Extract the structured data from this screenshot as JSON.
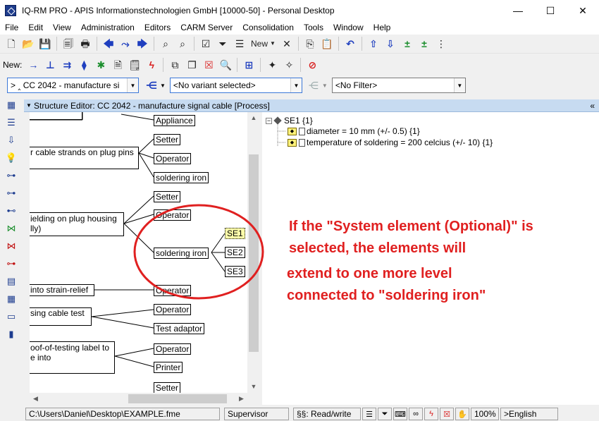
{
  "window": {
    "title": "IQ-RM PRO - APIS Informationstechnologien GmbH [10000-50] - Personal Desktop",
    "controls": {
      "minimize": "—",
      "maximize": "☐",
      "close": "✕"
    }
  },
  "menu": [
    "File",
    "Edit",
    "View",
    "Administration",
    "Editors",
    "CARM Server",
    "Consolidation",
    "Tools",
    "Window",
    "Help"
  ],
  "toolbar1": {
    "new_label": "New"
  },
  "toolbar2": {
    "new_label": "New:"
  },
  "toolbar3": {
    "structure_combo": "> ‸ CC 2042 - manufacture si",
    "variant_combo": "<No variant selected>",
    "filter_combo": "<No Filter>"
  },
  "editor": {
    "header": "Structure Editor: CC 2042 - manufacture signal cable [Process]",
    "structure_nodes": {
      "appliance": "Appliance",
      "setter_1": "Setter",
      "process_1": "r cable strands on plug pins",
      "operator_1": "Operator",
      "soldering_iron_1": "soldering iron",
      "setter_2": "Setter",
      "operator_2": "Operator",
      "process_2_line1": "ielding on plug housing",
      "process_2_line2": "lly)",
      "soldering_iron_2": "soldering iron",
      "se1": "SE1",
      "se2": "SE2",
      "se3": "SE3",
      "process_3": " into strain-relief",
      "operator_3": "Operator",
      "process_4": "sing cable test",
      "operator_4": "Operator",
      "test_adaptor": "Test adaptor",
      "process_5_line1": "oof-of-testing label to",
      "process_5_line2": "e into",
      "operator_5": "Operator",
      "printer": "Printer",
      "setter_3": "Setter"
    },
    "tree": {
      "root": "SE1 {1}",
      "children": [
        "diameter = 10 mm (+/- 0.5) {1}",
        "temperature of soldering = 200 celcius (+/- 10) {1}"
      ]
    }
  },
  "annotation": {
    "line1": "If the \"System element (Optional)\" is",
    "line2": "selected,  the elements will",
    "line3": "extend to one more level",
    "line4": "connected to \"soldering iron\"",
    "color": "#e02020"
  },
  "statusbar": {
    "path": "C:\\Users\\Daniel\\Desktop\\EXAMPLE.fme",
    "user": "Supervisor",
    "mode": "§§: Read/write",
    "zoom": "100%",
    "language": ">English"
  }
}
